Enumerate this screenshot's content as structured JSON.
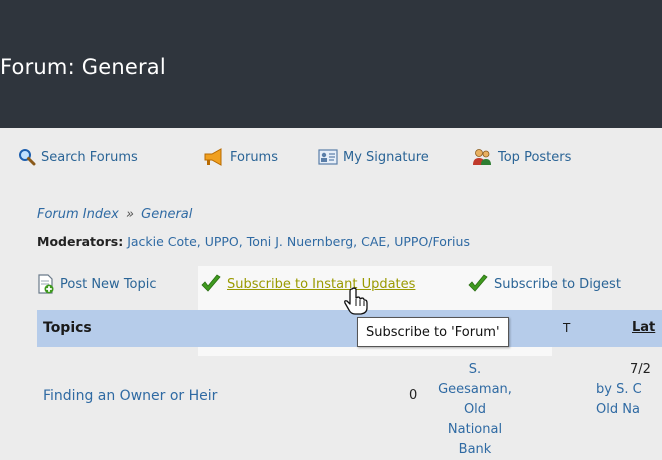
{
  "header": {
    "title": "Forum: General"
  },
  "toolbar": {
    "search": "Search Forums",
    "forums": "Forums",
    "signature": "My Signature",
    "top_posters": "Top Posters"
  },
  "breadcrumb": {
    "index": "Forum Index",
    "separator": "»",
    "current": "General"
  },
  "moderators": {
    "label": "Moderators:",
    "names": "Jackie Cote, UPPO, Toni J. Nuernberg, CAE, UPPO/Forius"
  },
  "actions": {
    "post_new": "Post New Topic",
    "subscribe_instant": "Subscribe to Instant Updates",
    "subscribe_digest": "Subscribe to Digest"
  },
  "table": {
    "col_topics": "Topics",
    "col_fragment": "T",
    "col_latest": "Lat",
    "rows": [
      {
        "title": "Finding an Owner or Heir",
        "replies": "0",
        "author_line1": "S. Geesaman,",
        "author_line2": "Old National",
        "author_line3": "Bank",
        "latest_line1": "7/2",
        "latest_by": "by S. C",
        "latest_line3": "Old Na"
      }
    ]
  },
  "tooltip": {
    "text": "Subscribe to 'Forum'"
  },
  "colors": {
    "header_bg": "#2f353d",
    "link": "#2f6aa3",
    "table_header_bg": "#b6ccea",
    "subscribe_link": "#9a9a00",
    "check_green": "#3f9a1f"
  }
}
